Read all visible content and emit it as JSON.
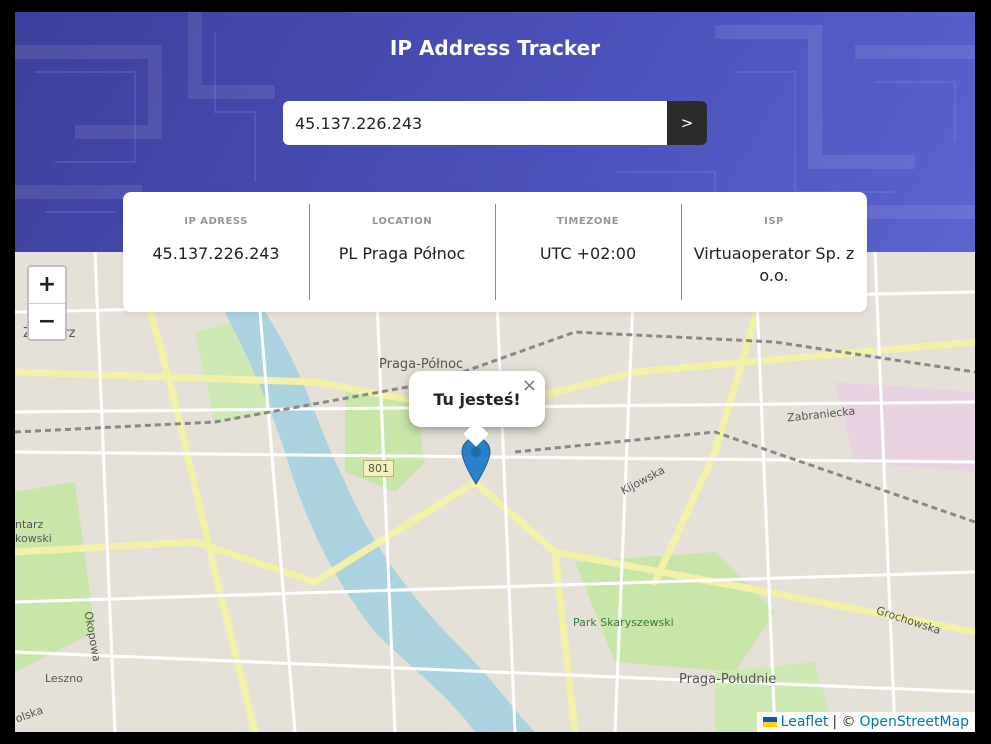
{
  "header": {
    "title": "IP Address Tracker"
  },
  "search": {
    "value": "45.137.226.243",
    "button_label": ">"
  },
  "info": [
    {
      "label": "IP ADRESS",
      "value": "45.137.226.243"
    },
    {
      "label": "LOCATION",
      "value": "PL Praga Północ"
    },
    {
      "label": "TIMEZONE",
      "value": "UTC +02:00"
    },
    {
      "label": "ISP",
      "value": "Virtuaoperator Sp. z o.o."
    }
  ],
  "map": {
    "zoom_in": "+",
    "zoom_out": "−",
    "popup_text": "Tu jesteś!",
    "popup_close": "×",
    "labels": {
      "zoliborz": "Żoliborz",
      "praga_polnoc": "Praga-Północ",
      "route": "801",
      "zabraniecka": "Zabraniecka",
      "kijowska": "Kijowska",
      "park": "Park Skaryszewski",
      "grochowska": "Grochowska",
      "praga_poludnie": "Praga-Południe",
      "okopowa": "Okopowa",
      "leszno": "Leszno",
      "teatr": "ntarz",
      "kowski": "kowski",
      "wolska": "olska"
    },
    "attribution": {
      "leaflet": "Leaflet",
      "separator": "| ©",
      "osm": "OpenStreetMap"
    }
  },
  "colors": {
    "header_start": "#3c3f9a",
    "header_end": "#5a63cf",
    "marker": "#2a81cb",
    "river": "#aad3df",
    "park": "#c8e6a8"
  }
}
